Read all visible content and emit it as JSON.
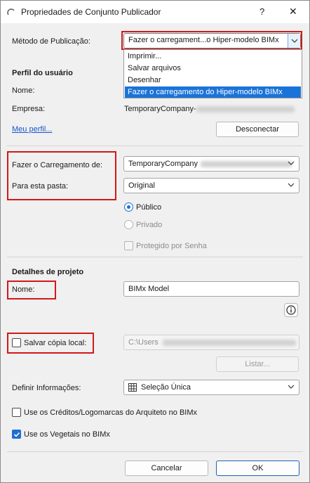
{
  "window": {
    "title": "Propriedades de Conjunto Publicador",
    "help_glyph": "?",
    "close_glyph": "✕"
  },
  "publish_method": {
    "label": "Método de Publicação:",
    "value": "Fazer o carregament...o Hiper-modelo BIMx",
    "options": [
      "Imprimir...",
      "Salvar arquivos",
      "Desenhar",
      "Fazer o carregamento do Hiper-modelo BIMx"
    ],
    "selected_index": 3
  },
  "user_profile": {
    "heading": "Perfil do usuário",
    "name_label": "Nome:",
    "company_label": "Empresa:",
    "company_value": "TemporaryCompany-",
    "my_profile_link": "Meu perfil...",
    "disconnect_button": "Desconectar"
  },
  "upload": {
    "upload_to_label": "Fazer o Carregamento de:",
    "upload_to_value": "TemporaryCompany",
    "folder_label": "Para esta pasta:",
    "folder_value": "Original",
    "public_label": "Público",
    "private_label": "Privado",
    "password_label": "Protegido por Senha"
  },
  "project": {
    "heading": "Detalhes de projeto",
    "name_label": "Nome:",
    "name_value": "BIMx Model",
    "info_glyph": "i"
  },
  "local_copy": {
    "label": "Salvar cópia local:",
    "path_value": "C:\\Users",
    "browse_button": "Listar..."
  },
  "info": {
    "label": "Definir Informações:",
    "value": "Seleção Única"
  },
  "options": {
    "credits_label": "Use os Créditos/Logomarcas do Arquiteto no BIMx",
    "credits_checked": false,
    "vegetation_label": "Use os Vegetais no BIMx",
    "vegetation_checked": true
  },
  "footer": {
    "cancel_button": "Cancelar",
    "ok_button": "OK"
  },
  "colors": {
    "highlight": "#d21818",
    "accent": "#1a73d9"
  }
}
